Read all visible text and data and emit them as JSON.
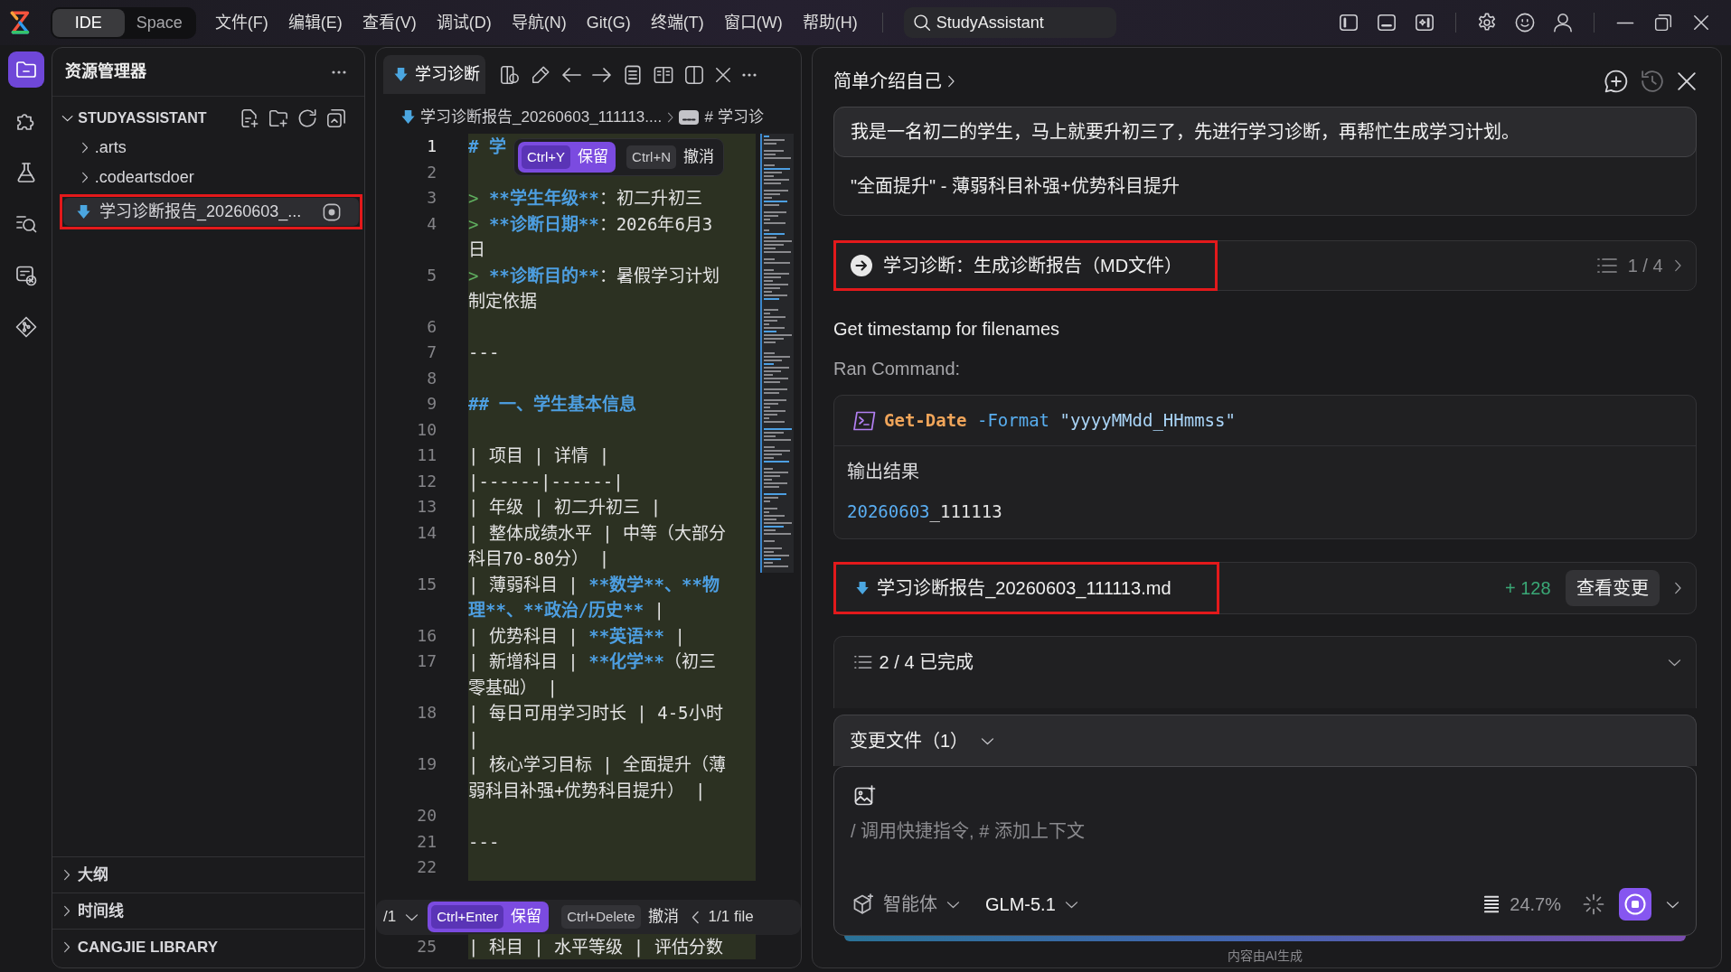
{
  "titlebar": {
    "modes": [
      {
        "label": "IDE",
        "selected": true
      },
      {
        "label": "Space",
        "selected": false
      }
    ],
    "menu": [
      "文件(F)",
      "编辑(E)",
      "查看(V)",
      "调试(D)",
      "导航(N)",
      "Git(G)",
      "终端(T)",
      "窗口(W)",
      "帮助(H)"
    ],
    "search": {
      "label": "StudyAssistant"
    }
  },
  "activity_bar": [
    {
      "selected": true
    },
    {
      "selected": false
    },
    {
      "selected": false
    },
    {
      "selected": false
    },
    {
      "selected": false
    },
    {
      "selected": false
    }
  ],
  "explorer": {
    "title": "资源管理器",
    "project": {
      "name": "STUDYASSISTANT",
      "expanded": true,
      "children": [
        {
          "name": ".arts",
          "kind": "folder",
          "expanded": false,
          "selected": false,
          "highlighted": false,
          "modified": false
        },
        {
          "name": ".codeartsdoer",
          "kind": "folder",
          "expanded": false,
          "selected": false,
          "highlighted": false,
          "modified": false
        },
        {
          "name": "学习诊断报告_20260603_...",
          "kind": "file",
          "selected": true,
          "highlighted": true,
          "modified": true
        }
      ]
    },
    "sections": [
      {
        "title": "大纲",
        "expanded": false
      },
      {
        "title": "时间线",
        "expanded": false
      },
      {
        "title": "CANGJIE LIBRARY",
        "expanded": false
      }
    ]
  },
  "editor": {
    "tabs": [
      {
        "label": "学习诊断",
        "selected": true
      }
    ],
    "breadcrumb": [
      "学习诊断报告_20260603_111113....",
      "# 学习诊"
    ],
    "inline_actions": [
      {
        "keys": "Ctrl+Y",
        "label": "保留",
        "kind": "accept"
      },
      {
        "keys": "Ctrl+N",
        "label": "撤消",
        "kind": "reject"
      }
    ],
    "lines": [
      {
        "number": "1",
        "current": true,
        "added": true,
        "segments": [
          {
            "text": "# 学",
            "kind": "heading"
          }
        ]
      },
      {
        "number": "2",
        "current": false,
        "added": true
      },
      {
        "number": "3",
        "current": false,
        "added": true,
        "segments": [
          {
            "text": ">",
            "kind": "marker"
          },
          {
            "text": " **学生年级**",
            "kind": "strong"
          },
          {
            "text": "：初二升初三",
            "kind": "text"
          }
        ]
      },
      {
        "number": "4",
        "current": false,
        "added": true,
        "segments": [
          {
            "text": ">",
            "kind": "marker"
          },
          {
            "text": " **诊断日期**",
            "kind": "strong"
          },
          {
            "text": "：2026年6月3日",
            "kind": "text"
          }
        ]
      },
      {
        "number": "5",
        "current": false,
        "added": true,
        "segments": [
          {
            "text": ">",
            "kind": "marker"
          },
          {
            "text": " **诊断目的**",
            "kind": "strong"
          },
          {
            "text": "：暑假学习计划制定依据",
            "kind": "text"
          }
        ]
      },
      {
        "number": "6",
        "current": false,
        "added": true
      },
      {
        "number": "7",
        "current": false,
        "added": true,
        "segments": [
          {
            "text": "---",
            "kind": "text"
          }
        ]
      },
      {
        "number": "8",
        "current": false,
        "added": true
      },
      {
        "number": "9",
        "current": false,
        "added": true,
        "segments": [
          {
            "text": "## 一、学生基本信息",
            "kind": "heading"
          }
        ]
      },
      {
        "number": "10",
        "current": false,
        "added": true
      },
      {
        "number": "11",
        "current": false,
        "added": true,
        "segments": [
          {
            "text": "| 项目 | 详情 |",
            "kind": "text"
          }
        ]
      },
      {
        "number": "12",
        "current": false,
        "added": true,
        "segments": [
          {
            "text": "|------|------|",
            "kind": "text"
          }
        ]
      },
      {
        "number": "13",
        "current": false,
        "added": true,
        "segments": [
          {
            "text": "| 年级 | 初二升初三 |",
            "kind": "text"
          }
        ]
      },
      {
        "number": "14",
        "current": false,
        "added": true,
        "segments": [
          {
            "text": "| 整体成绩水平 | 中等（大部分科目70-80分） |",
            "kind": "text"
          }
        ]
      },
      {
        "number": "15",
        "current": false,
        "added": true,
        "segments": [
          {
            "text": "| 薄弱科目 | ",
            "kind": "text"
          },
          {
            "text": "**数学**、**物理**、**政治/历史**",
            "kind": "strong"
          },
          {
            "text": " |",
            "kind": "text"
          }
        ]
      },
      {
        "number": "16",
        "current": false,
        "added": true,
        "segments": [
          {
            "text": "| 优势科目 | ",
            "kind": "text"
          },
          {
            "text": "**英语**",
            "kind": "strong"
          },
          {
            "text": " |",
            "kind": "text"
          }
        ]
      },
      {
        "number": "17",
        "current": false,
        "added": true,
        "segments": [
          {
            "text": "| 新增科目 | ",
            "kind": "text"
          },
          {
            "text": "**化学**",
            "kind": "strong"
          },
          {
            "text": "（初三零基础） |",
            "kind": "text"
          }
        ]
      },
      {
        "number": "18",
        "current": false,
        "added": true,
        "segments": [
          {
            "text": "| 每日可用学习时长 | 4-5小时 |",
            "kind": "text"
          }
        ]
      },
      {
        "number": "19",
        "current": false,
        "added": true,
        "segments": [
          {
            "text": "| 核心学习目标 | 全面提升（薄弱科目补强+优势科目提升） |",
            "kind": "text"
          }
        ]
      },
      {
        "number": "20",
        "current": false,
        "added": true
      },
      {
        "number": "21",
        "current": false,
        "added": true,
        "segments": [
          {
            "text": "---",
            "kind": "text"
          }
        ]
      },
      {
        "number": "22",
        "current": false,
        "added": true
      }
    ],
    "diff_bar": {
      "position": "/1",
      "actions": [
        {
          "keys": "Ctrl+Enter",
          "label": "保留",
          "kind": "accept"
        },
        {
          "keys": "Ctrl+Delete",
          "label": "撤消",
          "kind": "reject"
        }
      ],
      "file_count": "1/1 file"
    },
    "trailing_lines": [
      {
        "number": "25",
        "current": false,
        "added": true,
        "segments": [
          {
            "text": "| 科目 | 水平等级 | 评估分数",
            "kind": "text"
          }
        ]
      }
    ]
  },
  "chat": {
    "title": "简单介绍自己",
    "header_actions": [
      {
        "disabled": false
      },
      {
        "disabled": true
      },
      {
        "disabled": false
      }
    ],
    "conversation": {
      "message": "我是一名初二的学生，马上就要升初三了，先进行学习诊断，再帮忙生成学习计划。",
      "reply": "\"全面提升\" - 薄弱科目补强+优势科目提升"
    },
    "step": {
      "title": "学习诊断：生成诊断报告（MD文件）",
      "progress": "1 / 4",
      "highlighted": true
    },
    "note": "Get timestamp for filenames",
    "command": {
      "label": "Ran Command:",
      "segments": [
        {
          "text": "Get-Date",
          "kind": "command"
        },
        {
          "text": " -Format",
          "kind": "parameter"
        },
        {
          "text": " \"yyyyMMdd_HHmmss\"",
          "kind": "string"
        }
      ],
      "output_label": "输出结果",
      "output": [
        {
          "text": "20260603",
          "kind": "number"
        },
        {
          "text": "_111113",
          "kind": "text"
        }
      ]
    },
    "file_change": {
      "name": "学习诊断报告_20260603_111113.md",
      "additions": "+ 128",
      "action": "查看变更",
      "highlighted": true
    },
    "todo": {
      "summary": "2 / 4 已完成"
    },
    "changed_files": {
      "title": "变更文件（1）"
    },
    "composer": {
      "placeholder": "/ 调用快捷指令, # 添加上下文",
      "mode": "智能体",
      "model": "GLM-5.1",
      "context_usage": "24.7%"
    },
    "footer": "内容由AI生成"
  }
}
